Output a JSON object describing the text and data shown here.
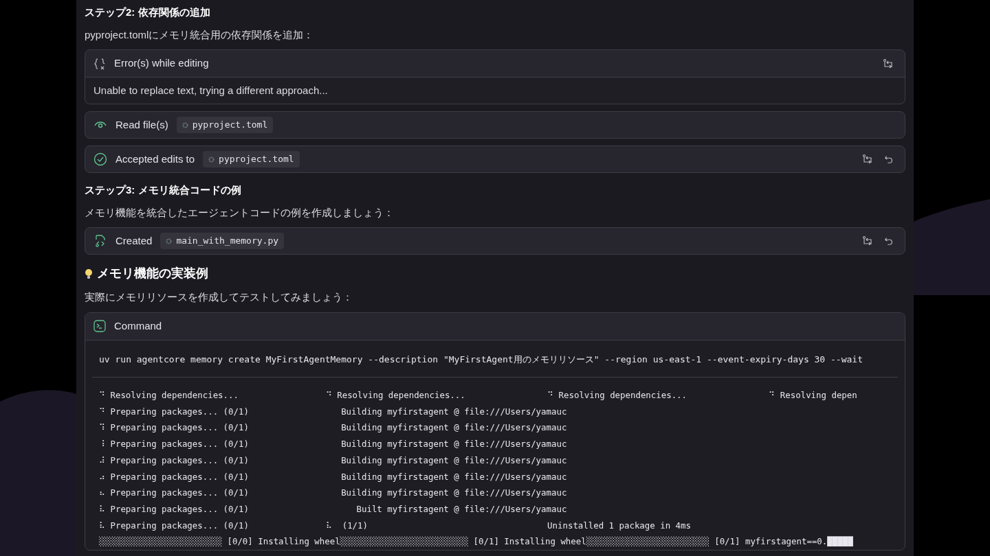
{
  "blocks": [
    {
      "kind": "heading",
      "text": "ステップ2: 依存関係の追加"
    },
    {
      "kind": "paragraph",
      "text": "pyproject.tomlにメモリ統合用の依存関係を追加："
    },
    {
      "kind": "error",
      "title": "Error(s) while editing",
      "message": "Unable to replace text, trying a different approach...",
      "actions": [
        {
          "kind": "compare"
        }
      ]
    },
    {
      "kind": "read",
      "label": "Read file(s)",
      "file": "pyproject.toml"
    },
    {
      "kind": "accepted",
      "label": "Accepted edits to",
      "file": "pyproject.toml",
      "actions": [
        {
          "kind": "compare"
        },
        {
          "kind": "undo"
        }
      ]
    },
    {
      "kind": "heading",
      "text": "ステップ3: メモリ統合コードの例"
    },
    {
      "kind": "paragraph",
      "text": "メモリ機能を統合したエージェントコードの例を作成しましょう："
    },
    {
      "kind": "created",
      "label": "Created",
      "file": "main_with_memory.py",
      "actions": [
        {
          "kind": "compare"
        },
        {
          "kind": "undo"
        }
      ]
    },
    {
      "kind": "title",
      "text": "メモリ機能の実装例"
    },
    {
      "kind": "paragraph",
      "text": "実際にメモリリソースを作成してテストしてみましょう："
    },
    {
      "kind": "command",
      "title": "Command",
      "command": "uv run agentcore memory create MyFirstAgentMemory --description \"MyFirstAgent用のメモリリソース\" --region us-east-1 --event-expiry-days 30 --wait",
      "output": [
        "⠙ Resolving dependencies...                 ⠙ Resolving dependencies...                ⠙ Resolving dependencies...                ⠙ Resolving depen",
        "⠙ Preparing packages... (0/1)                  Building myfirstagent @ file:///Users/yamauc",
        "⠹ Preparing packages... (0/1)                  Building myfirstagent @ file:///Users/yamauc",
        "⠸ Preparing packages... (0/1)                  Building myfirstagent @ file:///Users/yamauc",
        "⠼ Preparing packages... (0/1)                  Building myfirstagent @ file:///Users/yamauc",
        "⠴ Preparing packages... (0/1)                  Building myfirstagent @ file:///Users/yamauc",
        "⠦ Preparing packages... (0/1)                  Building myfirstagent @ file:///Users/yamauc",
        "⠧ Preparing packages... (0/1)                     Built myfirstagent @ file:///Users/yamauc",
        "⠧ Preparing packages... (0/1)               ⠧  (1/1)                                   Uninstalled 1 package in 4ms",
        "░░░░░░░░░░░░░░░░░░░░░░░░ [0/0] Installing wheel░░░░░░░░░░░░░░░░░░░░░░░░░ [0/1] Installing wheel░░░░░░░░░░░░░░░░░░░░░░░░ [0/1] myfirstagent==0.█████"
      ]
    }
  ]
}
